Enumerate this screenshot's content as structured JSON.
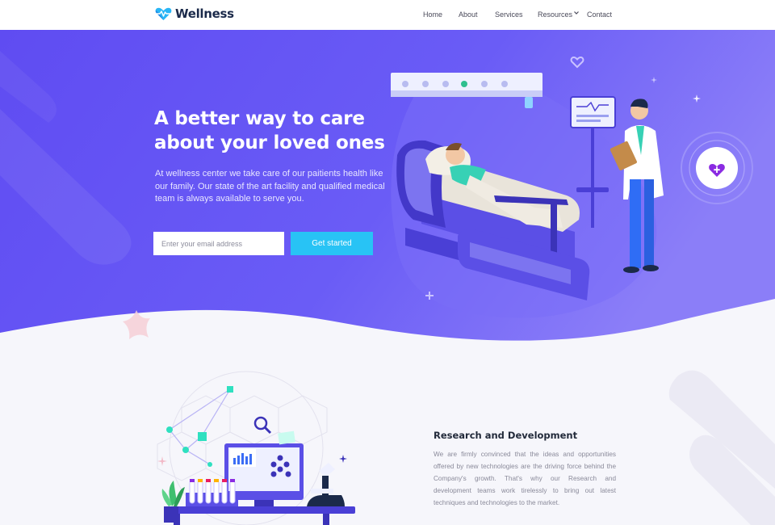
{
  "brand": {
    "name": "Wellness"
  },
  "nav": {
    "items": [
      {
        "label": "Home"
      },
      {
        "label": "About"
      },
      {
        "label": "Services"
      },
      {
        "label": "Resources"
      },
      {
        "label": "Contact"
      }
    ]
  },
  "hero": {
    "title_line1": "A better way to care",
    "title_line2": "about your loved ones",
    "description": "At wellness center we take care of our paitients health like our family. Our state of the art facility and qualified medical team is always available to serve you.",
    "email_placeholder": "Enter your email address",
    "cta_label": "Get started"
  },
  "research": {
    "title": "Research and Development",
    "text": "We are firmly convinced that the ideas and opportunities offered by new technologies are the driving force behind the Company's growth. That's why our Research and development teams work tirelessly to bring out latest techniques and technologies to the market."
  },
  "colors": {
    "hero_bg": "#6a5cf6",
    "hero_dark": "#5a44ec",
    "accent": "#28c3f5",
    "brand_dark": "#1b2a4a",
    "heart_accent": "#8a2be2"
  }
}
